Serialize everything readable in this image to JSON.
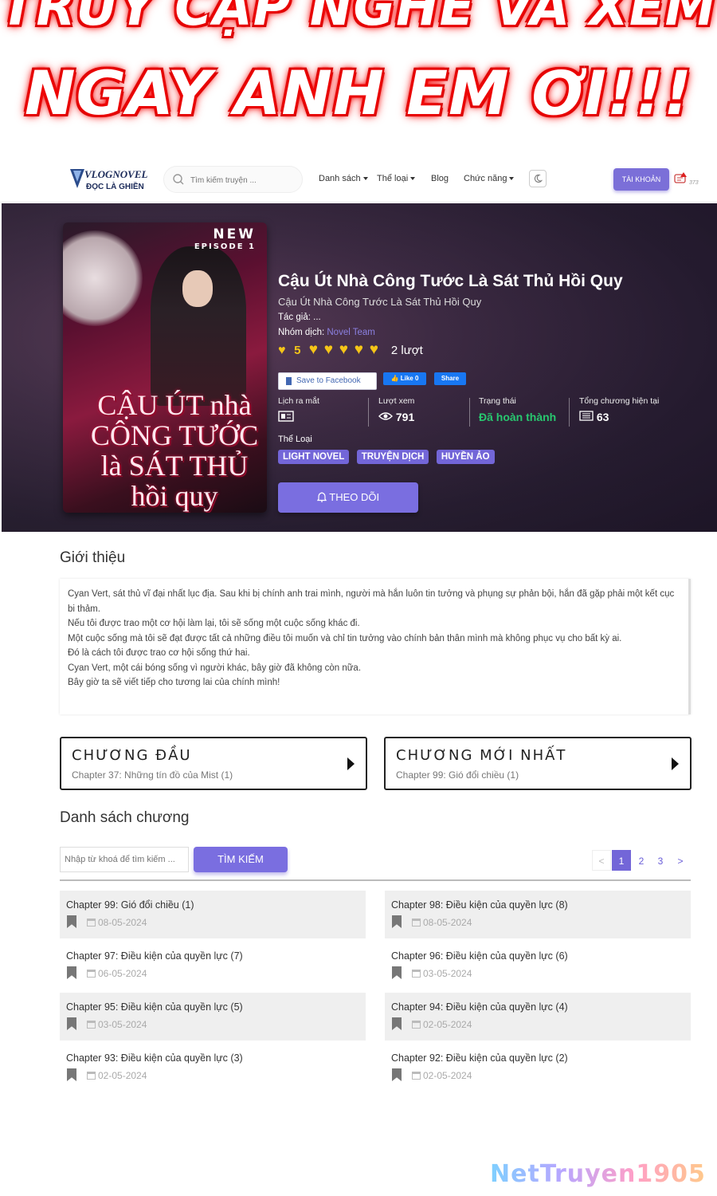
{
  "promo": {
    "line1": "TRUY CẬP NGHE VÀ XEM",
    "line2": "NGAY ANH EM ƠI!!!"
  },
  "nav": {
    "logo_title": "VLOGNOVEL",
    "logo_tagline": "ĐỌC LÀ GHIỀN",
    "search_placeholder": "Tìm kiếm truyện ...",
    "links": [
      "Danh sách",
      "Thể loại",
      "Blog",
      "Chức năng"
    ],
    "account_label": "TÀI KHOẢN",
    "notification_count": "373"
  },
  "novel": {
    "cover_badge_new": "NEW",
    "cover_badge_episode": "EPISODE",
    "cover_badge_num": "1",
    "cover_title": "CẬU ÚT nhà CÔNG TƯỚC là SÁT THỦ hồi quy",
    "title": "Cậu Út Nhà Công Tước Là Sát Thủ Hồi Quy",
    "alt_title": "Cậu Út Nhà Công Tước Là Sát Thủ Hồi Quy",
    "author_label": "Tác giả:",
    "author": "...",
    "group_label": "Nhóm dịch:",
    "group": "Novel Team",
    "rating_value": "5",
    "rating_hearts": 5,
    "rating_count": "2 lượt",
    "fb_save": "Save to Facebook",
    "fb_like": "Like 0",
    "fb_share": "Share",
    "stats": [
      {
        "label": "Lịch ra mắt",
        "value": ""
      },
      {
        "label": "Lượt xem",
        "value": "791"
      },
      {
        "label": "Trạng thái",
        "value": "Đã hoàn thành"
      },
      {
        "label": "Tổng chương hiện tại",
        "value": "63"
      }
    ],
    "genres_label": "Thể Loại",
    "genres": [
      "LIGHT NOVEL",
      "TRUYỆN DỊCH",
      "HUYỀN ẢO"
    ],
    "follow_label": "THEO DÕI"
  },
  "intro": {
    "heading": "Giới thiệu",
    "paragraphs": [
      "Cyan Vert, sát thủ vĩ đại nhất lục địa. Sau khi bị chính anh trai mình, người mà hắn luôn tin tưởng và phụng sự phản bội, hắn đã gặp phải một kết cục bi thảm.",
      "Nếu tôi được trao một cơ hội làm lại, tôi sẽ sống một cuộc sống khác đi.",
      "Một cuộc sống mà tôi sẽ đạt được tất cả những điều tôi muốn và chỉ tin tưởng vào chính bản thân mình mà không phục vụ cho bất kỳ ai.",
      "Đó là cách tôi được trao cơ hội sống thứ hai.",
      "Cyan Vert, một cái bóng sống vì người khác, bây giờ đã không còn nữa.",
      "Bây giờ ta sẽ viết tiếp cho tương lai của chính mình!"
    ]
  },
  "first_chapter": {
    "heading": "CHƯƠNG ĐẦU",
    "chapter": "Chapter 37: Những tín đồ của Mist (1)"
  },
  "latest_chapter": {
    "heading": "CHƯƠNG MỚI NHẤT",
    "chapter": "Chapter 99: Gió đổi chiều (1)"
  },
  "chapters": {
    "heading": "Danh sách chương",
    "filter_placeholder": "Nhập từ khoá để tìm kiếm ...",
    "search_label": "TÌM KIẾM",
    "pages": [
      "<",
      "1",
      "2",
      "3",
      ">"
    ],
    "active_page": "1",
    "list": [
      {
        "name": "Chapter 99: Gió đổi chiều (1)",
        "date": "08-05-2024"
      },
      {
        "name": "Chapter 98: Điều kiện của quyền lực (8)",
        "date": "08-05-2024"
      },
      {
        "name": "Chapter 97: Điều kiện của quyền lực (7)",
        "date": "06-05-2024"
      },
      {
        "name": "Chapter 96: Điều kiện của quyền lực (6)",
        "date": "03-05-2024"
      },
      {
        "name": "Chapter 95: Điều kiện của quyền lực (5)",
        "date": "03-05-2024"
      },
      {
        "name": "Chapter 94: Điều kiện của quyền lực (4)",
        "date": "02-05-2024"
      },
      {
        "name": "Chapter 93: Điều kiện của quyền lực (3)",
        "date": "02-05-2024"
      },
      {
        "name": "Chapter 92: Điều kiện của quyền lực (2)",
        "date": "02-05-2024"
      }
    ]
  },
  "watermark": "NetTruyen1905",
  "colors": {
    "accent": "#7366d8",
    "status_green": "#28c76f",
    "heart": "#f5c518",
    "promo_red": "#e00000"
  }
}
